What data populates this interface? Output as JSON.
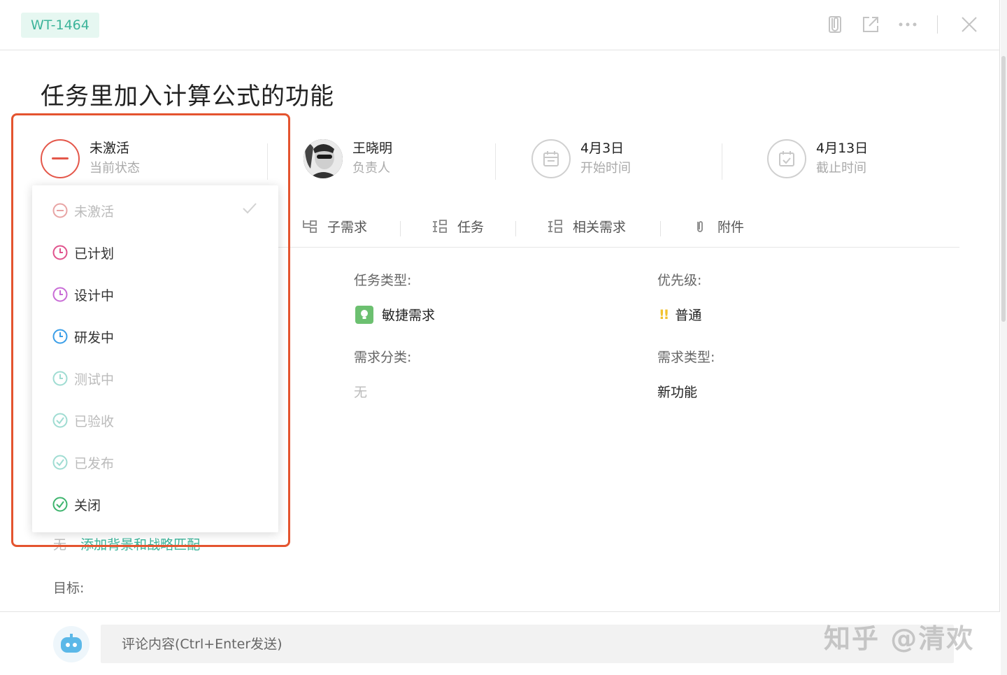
{
  "header": {
    "ticket_id": "WT-1464"
  },
  "title": "任务里加入计算公式的功能",
  "meta": {
    "status": {
      "value": "未激活",
      "label": "当前状态"
    },
    "owner": {
      "value": "王晓明",
      "label": "负责人"
    },
    "start": {
      "value": "4月3日",
      "label": "开始时间"
    },
    "due": {
      "value": "4月13日",
      "label": "截止时间"
    }
  },
  "tabs": [
    {
      "label": "子需求",
      "icon": "sub-requirement-icon"
    },
    {
      "label": "任务",
      "icon": "task-icon"
    },
    {
      "label": "相关需求",
      "icon": "related-icon"
    },
    {
      "label": "附件",
      "icon": "attachment-icon"
    }
  ],
  "fields": {
    "task_type": {
      "label": "任务类型:",
      "value": "敏捷需求"
    },
    "priority": {
      "label": "优先级:",
      "mark": "!!",
      "value": "普通"
    },
    "req_category": {
      "label": "需求分类:",
      "value": "无"
    },
    "req_type": {
      "label": "需求类型:",
      "value": "新功能"
    }
  },
  "background": {
    "none": "无",
    "link": "添加背景和战略匹配"
  },
  "goal_label": "目标:",
  "comment": {
    "placeholder": "评论内容(Ctrl+Enter发送)"
  },
  "watermark": "知乎 @清欢",
  "status_dropdown": {
    "items": [
      {
        "label": "未激活",
        "color": "#e88a8a",
        "icon": "minus-circle-icon",
        "selected": true,
        "dim": true
      },
      {
        "label": "已计划",
        "color": "#e0528c",
        "icon": "clock-icon",
        "selected": false,
        "dim": false
      },
      {
        "label": "设计中",
        "color": "#c86bd6",
        "icon": "clock-icon",
        "selected": false,
        "dim": false
      },
      {
        "label": "研发中",
        "color": "#3a9ee8",
        "icon": "clock-icon",
        "selected": false,
        "dim": false
      },
      {
        "label": "测试中",
        "color": "#7fd6c8",
        "icon": "clock-icon",
        "selected": false,
        "dim": true
      },
      {
        "label": "已验收",
        "color": "#7fd6c8",
        "icon": "check-circle-icon",
        "selected": false,
        "dim": true
      },
      {
        "label": "已发布",
        "color": "#7fd6c8",
        "icon": "check-circle-icon",
        "selected": false,
        "dim": true
      },
      {
        "label": "关闭",
        "color": "#3db46d",
        "icon": "check-circle-icon",
        "selected": false,
        "dim": false
      }
    ]
  },
  "colors": {
    "accent": "#3cb49a",
    "status_inactive": "#e4574a",
    "highlight_box": "#e4542f"
  }
}
